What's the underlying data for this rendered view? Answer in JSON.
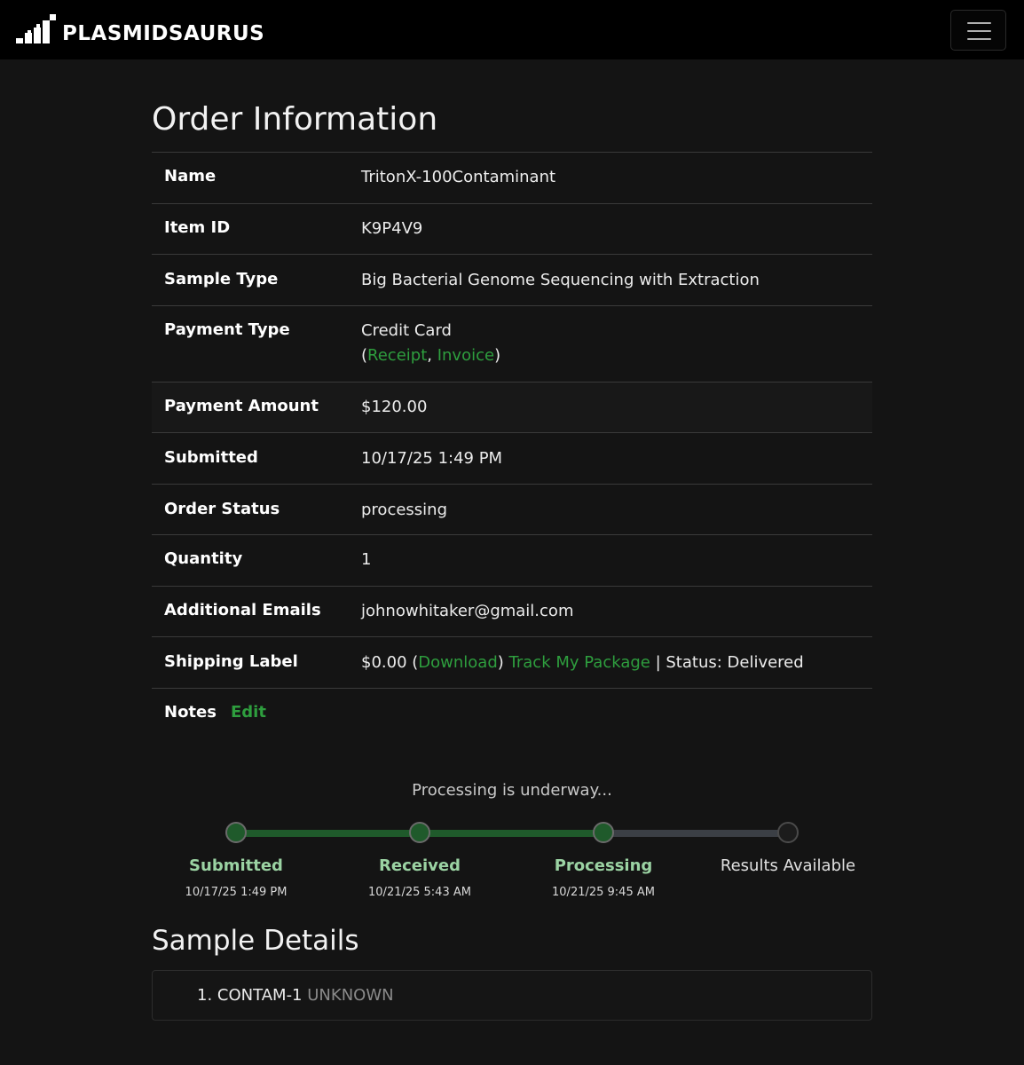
{
  "brand": {
    "name": "PLASMIDSAURUS"
  },
  "page": {
    "title": "Order Information"
  },
  "order": {
    "rows": [
      {
        "label": "Name",
        "value": "TritonX-100Contaminant"
      },
      {
        "label": "Item ID",
        "value": "K9P4V9"
      },
      {
        "label": "Sample Type",
        "value": "Big Bacterial Genome Sequencing with Extraction"
      },
      {
        "label": "Payment Type",
        "value": "Credit Card"
      },
      {
        "label": "Payment Amount",
        "value": "$120.00"
      },
      {
        "label": "Submitted",
        "value": "10/17/25 1:49 PM"
      },
      {
        "label": "Order Status",
        "value": "processing"
      },
      {
        "label": "Quantity",
        "value": "1"
      },
      {
        "label": "Additional Emails",
        "value": "johnowhitaker@gmail.com"
      },
      {
        "label": "Shipping Label",
        "value": "$0.00"
      },
      {
        "label": "Notes",
        "value": ""
      }
    ],
    "payment_links": {
      "open": "(",
      "receipt": "Receipt",
      "sep": ", ",
      "invoice": "Invoice",
      "close": ")"
    },
    "shipping": {
      "open": " (",
      "download": "Download",
      "close": ") ",
      "track": "Track My Package",
      "status": " | Status: Delivered"
    },
    "notes_edit": "Edit"
  },
  "progress": {
    "title": "Processing is underway...",
    "steps": [
      {
        "label": "Submitted",
        "date": "10/17/25 1:49 PM",
        "done": true
      },
      {
        "label": "Received",
        "date": "10/21/25 5:43 AM",
        "done": true
      },
      {
        "label": "Processing",
        "date": "10/21/25 9:45 AM",
        "done": true
      },
      {
        "label": "Results Available",
        "date": "",
        "done": false
      }
    ],
    "completed_fraction": 0.667
  },
  "samples": {
    "title": "Sample Details",
    "items": [
      {
        "number": "1.",
        "name": "CONTAM-1",
        "status": "UNKNOWN"
      }
    ]
  },
  "colors": {
    "background": "#141414",
    "navbar": "#000000",
    "link_green": "#2e9e3e",
    "step_done": "#1f5a2b",
    "step_label_done": "#9bd3a3",
    "track_done": "#1f5a2b",
    "track_todo": "#3b3f45"
  }
}
